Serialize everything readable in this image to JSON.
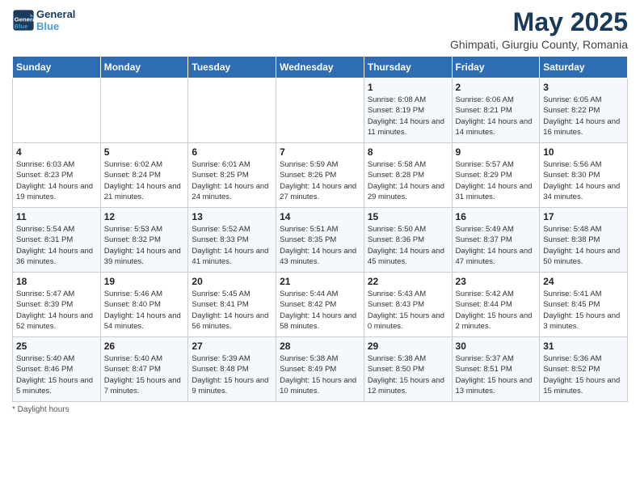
{
  "header": {
    "logo_line1": "General",
    "logo_line2": "Blue",
    "title": "May 2025",
    "subtitle": "Ghimpati, Giurgiu County, Romania"
  },
  "weekdays": [
    "Sunday",
    "Monday",
    "Tuesday",
    "Wednesday",
    "Thursday",
    "Friday",
    "Saturday"
  ],
  "weeks": [
    [
      {
        "day": "",
        "info": ""
      },
      {
        "day": "",
        "info": ""
      },
      {
        "day": "",
        "info": ""
      },
      {
        "day": "",
        "info": ""
      },
      {
        "day": "1",
        "info": "Sunrise: 6:08 AM\nSunset: 8:19 PM\nDaylight: 14 hours\nand 11 minutes."
      },
      {
        "day": "2",
        "info": "Sunrise: 6:06 AM\nSunset: 8:21 PM\nDaylight: 14 hours\nand 14 minutes."
      },
      {
        "day": "3",
        "info": "Sunrise: 6:05 AM\nSunset: 8:22 PM\nDaylight: 14 hours\nand 16 minutes."
      }
    ],
    [
      {
        "day": "4",
        "info": "Sunrise: 6:03 AM\nSunset: 8:23 PM\nDaylight: 14 hours\nand 19 minutes."
      },
      {
        "day": "5",
        "info": "Sunrise: 6:02 AM\nSunset: 8:24 PM\nDaylight: 14 hours\nand 21 minutes."
      },
      {
        "day": "6",
        "info": "Sunrise: 6:01 AM\nSunset: 8:25 PM\nDaylight: 14 hours\nand 24 minutes."
      },
      {
        "day": "7",
        "info": "Sunrise: 5:59 AM\nSunset: 8:26 PM\nDaylight: 14 hours\nand 27 minutes."
      },
      {
        "day": "8",
        "info": "Sunrise: 5:58 AM\nSunset: 8:28 PM\nDaylight: 14 hours\nand 29 minutes."
      },
      {
        "day": "9",
        "info": "Sunrise: 5:57 AM\nSunset: 8:29 PM\nDaylight: 14 hours\nand 31 minutes."
      },
      {
        "day": "10",
        "info": "Sunrise: 5:56 AM\nSunset: 8:30 PM\nDaylight: 14 hours\nand 34 minutes."
      }
    ],
    [
      {
        "day": "11",
        "info": "Sunrise: 5:54 AM\nSunset: 8:31 PM\nDaylight: 14 hours\nand 36 minutes."
      },
      {
        "day": "12",
        "info": "Sunrise: 5:53 AM\nSunset: 8:32 PM\nDaylight: 14 hours\nand 39 minutes."
      },
      {
        "day": "13",
        "info": "Sunrise: 5:52 AM\nSunset: 8:33 PM\nDaylight: 14 hours\nand 41 minutes."
      },
      {
        "day": "14",
        "info": "Sunrise: 5:51 AM\nSunset: 8:35 PM\nDaylight: 14 hours\nand 43 minutes."
      },
      {
        "day": "15",
        "info": "Sunrise: 5:50 AM\nSunset: 8:36 PM\nDaylight: 14 hours\nand 45 minutes."
      },
      {
        "day": "16",
        "info": "Sunrise: 5:49 AM\nSunset: 8:37 PM\nDaylight: 14 hours\nand 47 minutes."
      },
      {
        "day": "17",
        "info": "Sunrise: 5:48 AM\nSunset: 8:38 PM\nDaylight: 14 hours\nand 50 minutes."
      }
    ],
    [
      {
        "day": "18",
        "info": "Sunrise: 5:47 AM\nSunset: 8:39 PM\nDaylight: 14 hours\nand 52 minutes."
      },
      {
        "day": "19",
        "info": "Sunrise: 5:46 AM\nSunset: 8:40 PM\nDaylight: 14 hours\nand 54 minutes."
      },
      {
        "day": "20",
        "info": "Sunrise: 5:45 AM\nSunset: 8:41 PM\nDaylight: 14 hours\nand 56 minutes."
      },
      {
        "day": "21",
        "info": "Sunrise: 5:44 AM\nSunset: 8:42 PM\nDaylight: 14 hours\nand 58 minutes."
      },
      {
        "day": "22",
        "info": "Sunrise: 5:43 AM\nSunset: 8:43 PM\nDaylight: 15 hours\nand 0 minutes."
      },
      {
        "day": "23",
        "info": "Sunrise: 5:42 AM\nSunset: 8:44 PM\nDaylight: 15 hours\nand 2 minutes."
      },
      {
        "day": "24",
        "info": "Sunrise: 5:41 AM\nSunset: 8:45 PM\nDaylight: 15 hours\nand 3 minutes."
      }
    ],
    [
      {
        "day": "25",
        "info": "Sunrise: 5:40 AM\nSunset: 8:46 PM\nDaylight: 15 hours\nand 5 minutes."
      },
      {
        "day": "26",
        "info": "Sunrise: 5:40 AM\nSunset: 8:47 PM\nDaylight: 15 hours\nand 7 minutes."
      },
      {
        "day": "27",
        "info": "Sunrise: 5:39 AM\nSunset: 8:48 PM\nDaylight: 15 hours\nand 9 minutes."
      },
      {
        "day": "28",
        "info": "Sunrise: 5:38 AM\nSunset: 8:49 PM\nDaylight: 15 hours\nand 10 minutes."
      },
      {
        "day": "29",
        "info": "Sunrise: 5:38 AM\nSunset: 8:50 PM\nDaylight: 15 hours\nand 12 minutes."
      },
      {
        "day": "30",
        "info": "Sunrise: 5:37 AM\nSunset: 8:51 PM\nDaylight: 15 hours\nand 13 minutes."
      },
      {
        "day": "31",
        "info": "Sunrise: 5:36 AM\nSunset: 8:52 PM\nDaylight: 15 hours\nand 15 minutes."
      }
    ]
  ],
  "footer": "Daylight hours"
}
